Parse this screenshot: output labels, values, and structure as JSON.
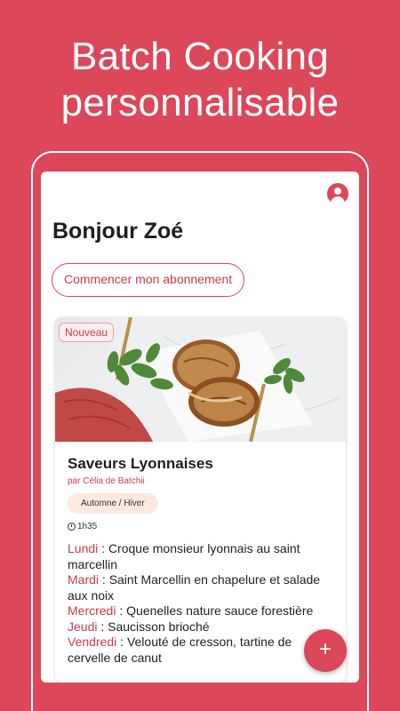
{
  "promo": {
    "line1": "Batch Cooking",
    "line2": "personnalisable"
  },
  "header": {
    "greeting": "Bonjour Zoé",
    "profile_icon": "account-circle-icon"
  },
  "subscription_button": "Commencer mon abonnement",
  "card": {
    "badge": "Nouveau",
    "title": "Saveurs Lyonnaises",
    "author": "par Célia de Batchii",
    "season": "Automne / Hiver",
    "duration": "1h35",
    "menu": [
      {
        "day": "Lundi",
        "sep": " : ",
        "dish": "Croque monsieur lyonnais au saint marcellin"
      },
      {
        "day": "Mardi",
        "sep": " : ",
        "dish": "Saint Marcellin en chapelure et salade aux noix"
      },
      {
        "day": "Mercredi",
        "sep": " : ",
        "dish": "Quenelles nature sauce forestière"
      },
      {
        "day": "Jeudi",
        "sep": " : ",
        "dish": "Saucisson brioché"
      },
      {
        "day": "Vendredi",
        "sep": " : ",
        "dish": "Velouté de cresson, tartine de cervelle de canut"
      }
    ]
  },
  "fab_label": "+",
  "colors": {
    "brand": "#dc4759",
    "accent_text": "#c73b4d",
    "tag_bg": "#fde9de"
  }
}
